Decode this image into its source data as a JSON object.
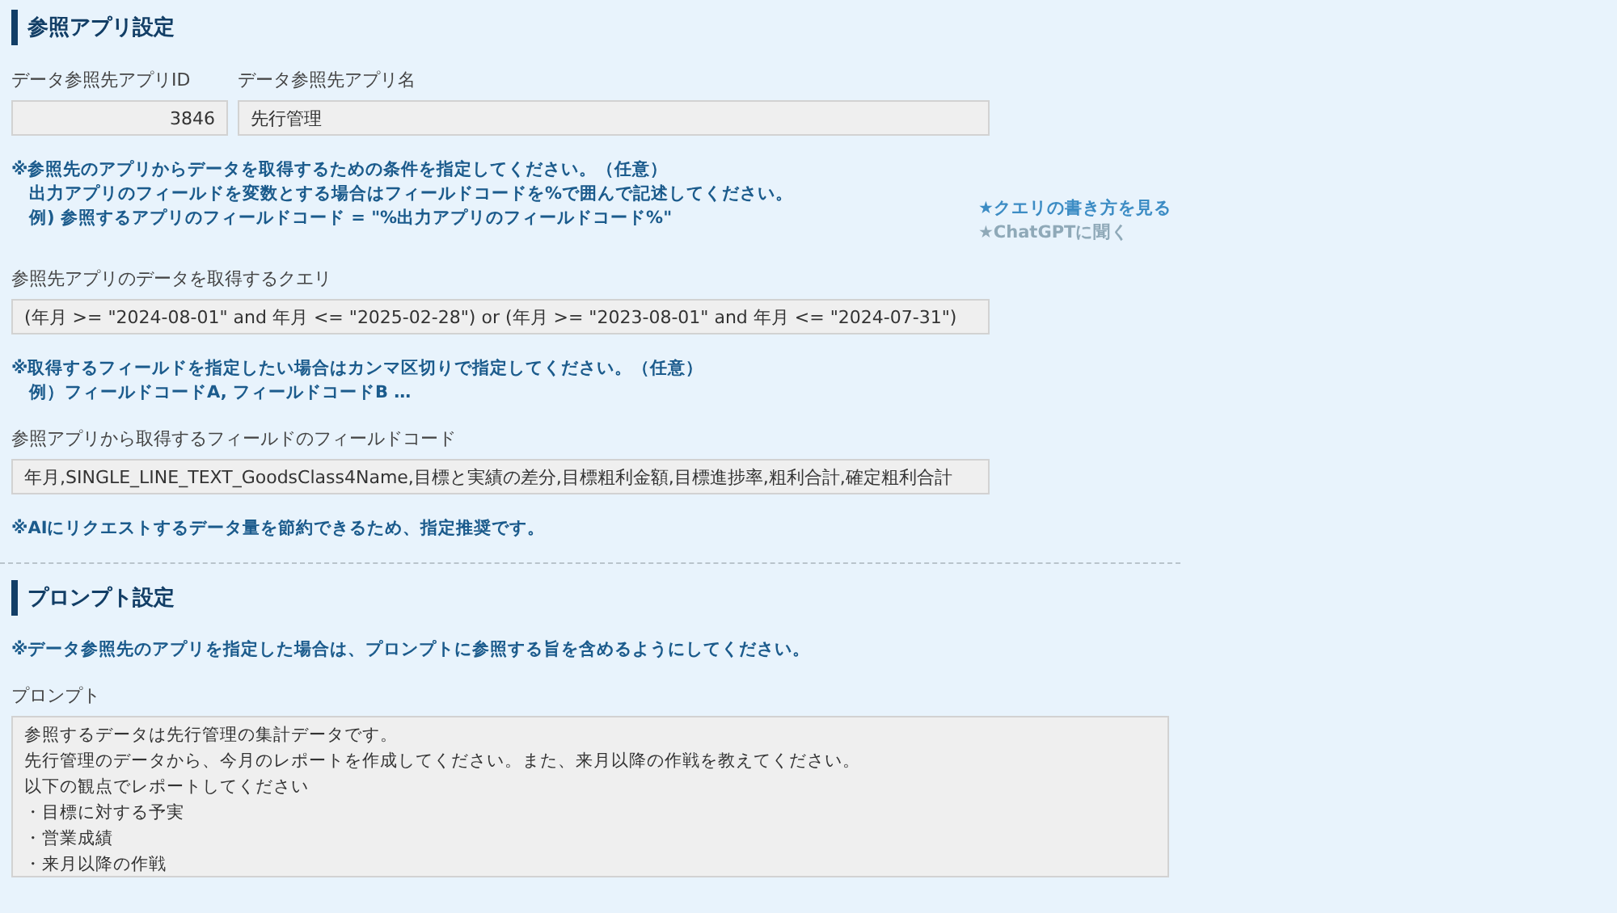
{
  "sections": [
    {
      "title": "参照アプリ設定",
      "blocks": [
        {
          "kind": "fields",
          "fields": [
            {
              "label": "データ参照先アプリID",
              "value": "3846",
              "kind": "number"
            },
            {
              "label": "データ参照先アプリ名",
              "value": "先行管理",
              "kind": "text"
            }
          ]
        },
        {
          "kind": "note",
          "lines": [
            "※参照先のアプリからデータを取得するための条件を指定してください。（任意）",
            "出力アプリのフィールドを変数とする場合はフィールドコードを%で囲んで記述してください。",
            "例) 参照するアプリのフィールドコード = \"%出力アプリのフィールドコード%\""
          ],
          "links": [
            {
              "text": "★クエリの書き方を見る",
              "disabled": false
            },
            {
              "text": "★ChatGPTに聞く",
              "disabled": true
            }
          ]
        },
        {
          "kind": "fields",
          "fields": [
            {
              "label": "参照先アプリのデータを取得するクエリ",
              "value": "(年月 >= \"2024-08-01\" and 年月 <= \"2025-02-28\") or (年月 >= \"2023-08-01\" and 年月 <= \"2024-07-31\")",
              "kind": "text"
            }
          ]
        },
        {
          "kind": "note",
          "lines": [
            "※取得するフィールドを指定したい場合はカンマ区切りで指定してください。（任意）",
            "例）フィールドコードA, フィールドコードB …"
          ]
        },
        {
          "kind": "fields",
          "fields": [
            {
              "label": "参照アプリから取得するフィールドのフィールドコード",
              "value": "年月,SINGLE_LINE_TEXT_GoodsClass4Name,目標と実績の差分,目標粗利金額,目標進捗率,粗利合計,確定粗利合計",
              "kind": "text"
            }
          ]
        },
        {
          "kind": "note",
          "lines": [
            "※AIにリクエストするデータ量を節約できるため、指定推奨です。"
          ]
        }
      ]
    },
    {
      "title": "プロンプト設定",
      "blocks": [
        {
          "kind": "note",
          "lines": [
            "※データ参照先のアプリを指定した場合は、プロンプトに参照する旨を含めるようにしてください。"
          ]
        },
        {
          "kind": "textarea",
          "label": "プロンプト",
          "lines": [
            "参照するデータは先行管理の集計データです。",
            "先行管理のデータから、今月のレポートを作成してください。また、来月以降の作戦を教えてください。",
            "以下の観点でレポートしてください",
            "・目標に対する予実",
            "・営業成績",
            "・来月以降の作戦"
          ]
        }
      ]
    }
  ]
}
